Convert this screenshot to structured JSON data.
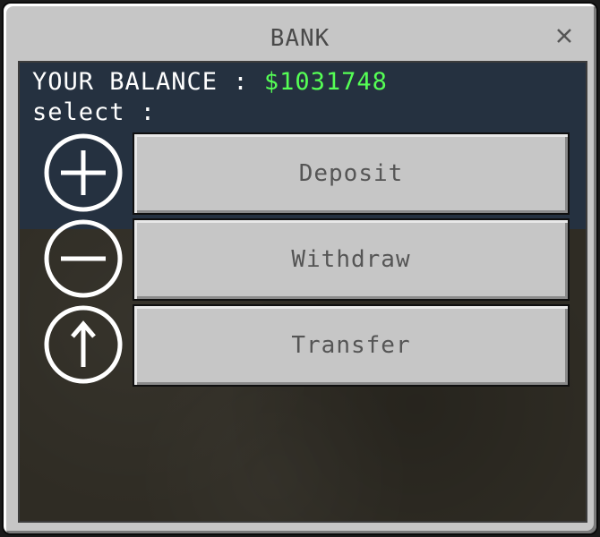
{
  "window": {
    "title": "BANK"
  },
  "balance": {
    "label": "YOUR BALANCE :",
    "value": "$1031748"
  },
  "select_label": "select :",
  "actions": [
    {
      "label": "Deposit",
      "icon": "plus-circle-icon"
    },
    {
      "label": "Withdraw",
      "icon": "minus-circle-icon"
    },
    {
      "label": "Transfer",
      "icon": "arrow-up-circle-icon"
    }
  ],
  "colors": {
    "balance_value": "#55ff55",
    "label_text": "#ffffff",
    "button_text": "#555555",
    "title_text": "#4a4a4a",
    "panel_top": "#253140",
    "panel_bottom": "#2f2c24",
    "dialog_bg": "#c6c6c6"
  }
}
